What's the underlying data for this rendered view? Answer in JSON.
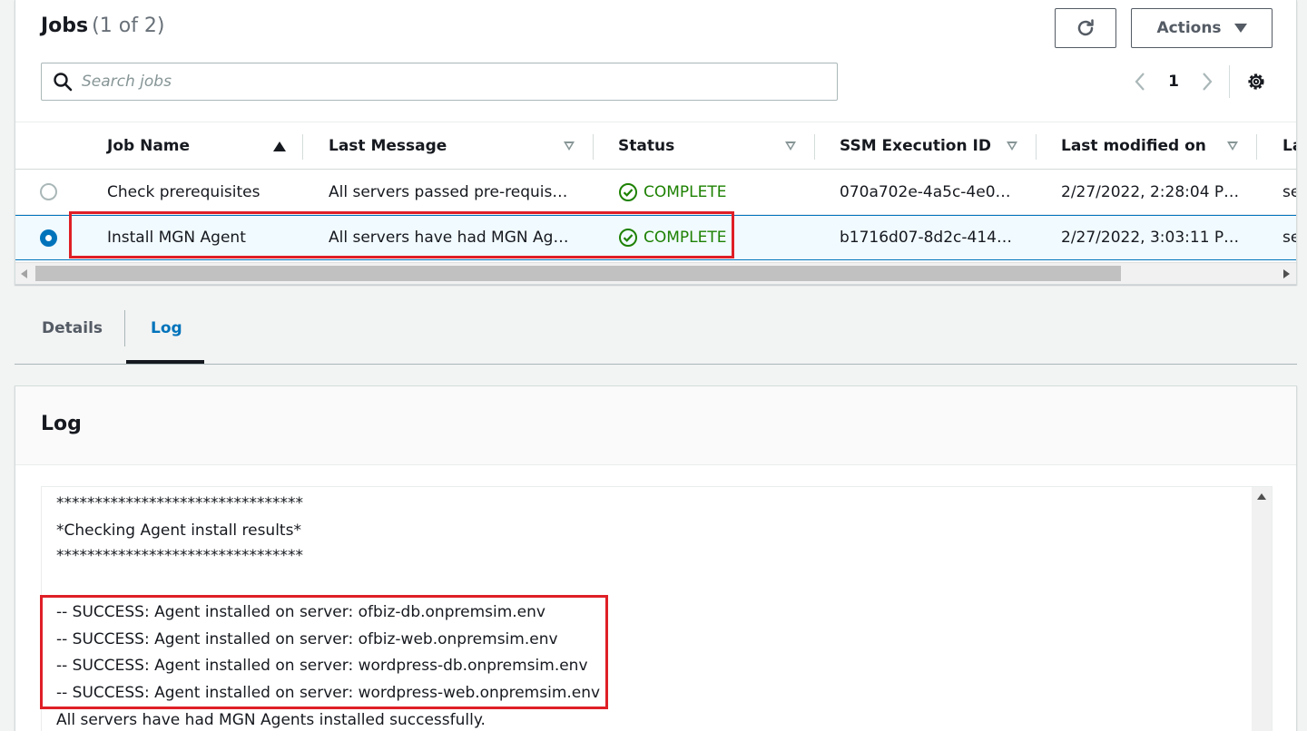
{
  "jobs": {
    "title": "Jobs",
    "count": "(1 of 2)",
    "refresh_icon": "refresh-icon",
    "actions_label": "Actions",
    "search_placeholder": "Search jobs",
    "pagination": {
      "current_page": "1"
    },
    "columns": [
      "Job Name",
      "Last Message",
      "Status",
      "SSM Execution ID",
      "Last modified on",
      "La"
    ],
    "rows": [
      {
        "selected": false,
        "job_name": "Check prerequisites",
        "last_message": "All servers passed pre-requis…",
        "status": "COMPLETE",
        "ssm_execution_id": "070a702e-4a5c-4e0…",
        "last_modified": "2/27/2022, 2:28:04 P…",
        "next_col": "se"
      },
      {
        "selected": true,
        "job_name": "Install MGN Agent",
        "last_message": "All servers have had MGN Ag…",
        "status": "COMPLETE",
        "ssm_execution_id": "b1716d07-8d2c-414…",
        "last_modified": "2/27/2022, 3:03:11 P…",
        "next_col": "se"
      }
    ],
    "status_color": "#1d8102"
  },
  "tabs": [
    {
      "label": "Details",
      "active": false
    },
    {
      "label": "Log",
      "active": true
    }
  ],
  "log": {
    "title": "Log",
    "lines": [
      "********************************",
      "*Checking Agent install results*",
      "********************************",
      "",
      "-- SUCCESS: Agent installed on server: ofbiz-db.onpremsim.env",
      "-- SUCCESS: Agent installed on server: ofbiz-web.onpremsim.env",
      "-- SUCCESS: Agent installed on server: wordpress-db.onpremsim.env",
      "-- SUCCESS: Agent installed on server: wordpress-web.onpremsim.env",
      "All servers have had MGN Agents installed successfully."
    ]
  },
  "colors": {
    "accent": "#0073bb",
    "highlight": "#df1f26",
    "success": "#1d8102"
  }
}
